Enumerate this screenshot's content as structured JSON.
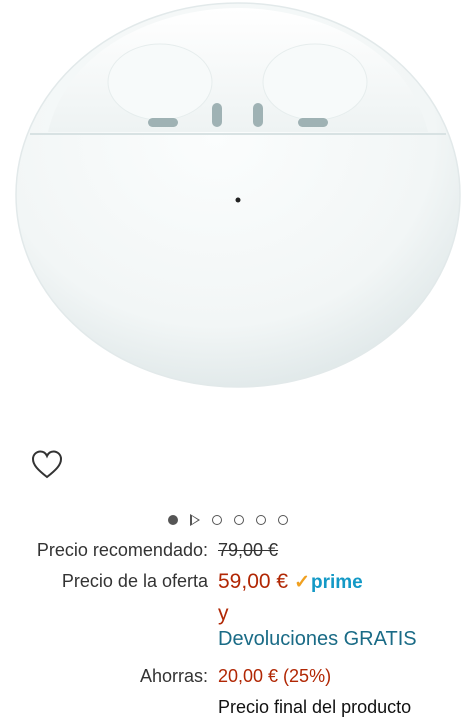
{
  "product": {
    "image_alt": "white earbuds charging case",
    "wishlist_icon": "heart-outline-icon"
  },
  "carousel": {
    "total_items": 6,
    "active_index": 0,
    "video_index": 1
  },
  "pricing": {
    "list_price_label": "Precio recomendado:",
    "list_price_value": "79,00 €",
    "offer_label": "Precio de la oferta",
    "offer_value": "59,00 €",
    "prime_check": "✓",
    "prime_label": "prime",
    "and_text": "y",
    "returns_text": "Devoluciones GRATIS",
    "savings_label": "Ahorras:",
    "savings_value": "20,00 € (25%)",
    "final_price_text": "Precio final del producto"
  },
  "colors": {
    "price_red": "#b12704",
    "prime_blue": "#1399c6",
    "link_teal": "#1a6b86"
  }
}
